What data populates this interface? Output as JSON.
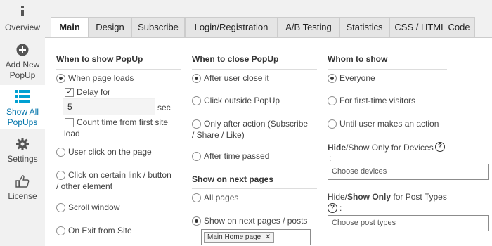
{
  "sidebar": {
    "items": [
      {
        "label": "Overview",
        "icon": "info-icon"
      },
      {
        "label_line1": "Add New",
        "label_line2": "PopUp",
        "icon": "plus-circle-icon"
      },
      {
        "label_line1": "Show All",
        "label_line2": "PopUps",
        "icon": "list-icon"
      },
      {
        "label": "Settings",
        "icon": "gear-icon"
      },
      {
        "label": "License",
        "icon": "thumbs-up-icon"
      }
    ]
  },
  "tabs": [
    "Main",
    "Design",
    "Subscribe",
    "Login/Registration",
    "A/B Testing",
    "Statistics",
    "CSS / HTML Code"
  ],
  "col1": {
    "title": "When to show PopUp",
    "opt_page_loads": "When page loads",
    "delay_label": "Delay for",
    "delay_value": "5",
    "delay_unit": "sec",
    "count_time_l1": "Count time from first site",
    "count_time_l2": "load",
    "opt_user_click": "User click on the page",
    "opt_link_l1": "Click on certain link / button",
    "opt_link_l2": "/ other element",
    "opt_scroll": "Scroll window",
    "opt_exit": "On Exit from Site"
  },
  "col2": {
    "title": "When to close PopUp",
    "opt_after_close": "After user close it",
    "opt_click_outside": "Click outside PopUp",
    "opt_after_action_l1": "Only after action (Subscribe",
    "opt_after_action_l2": "/ Share / Like)",
    "opt_after_time": "After time passed",
    "next_title": "Show on next pages",
    "opt_all_pages": "All pages",
    "opt_next_pages": "Show on next pages / posts",
    "tag_label": "Main Home page"
  },
  "col3": {
    "title": "Whom to show",
    "opt_everyone": "Everyone",
    "opt_first_time": "For first-time visitors",
    "opt_until_action": "Until user makes an action",
    "devices_hide": "Hide",
    "devices_rest": "/Show Only for Devices",
    "devices_colon": ":",
    "devices_placeholder": "Choose devices",
    "post_hide": "Hide/",
    "post_show_only": "Show Only",
    "post_rest": " for Post Types",
    "post_colon": ":",
    "post_placeholder": "Choose post types"
  },
  "colors": {
    "accent": "#0073aa",
    "active_icon": "#00a0d2"
  }
}
